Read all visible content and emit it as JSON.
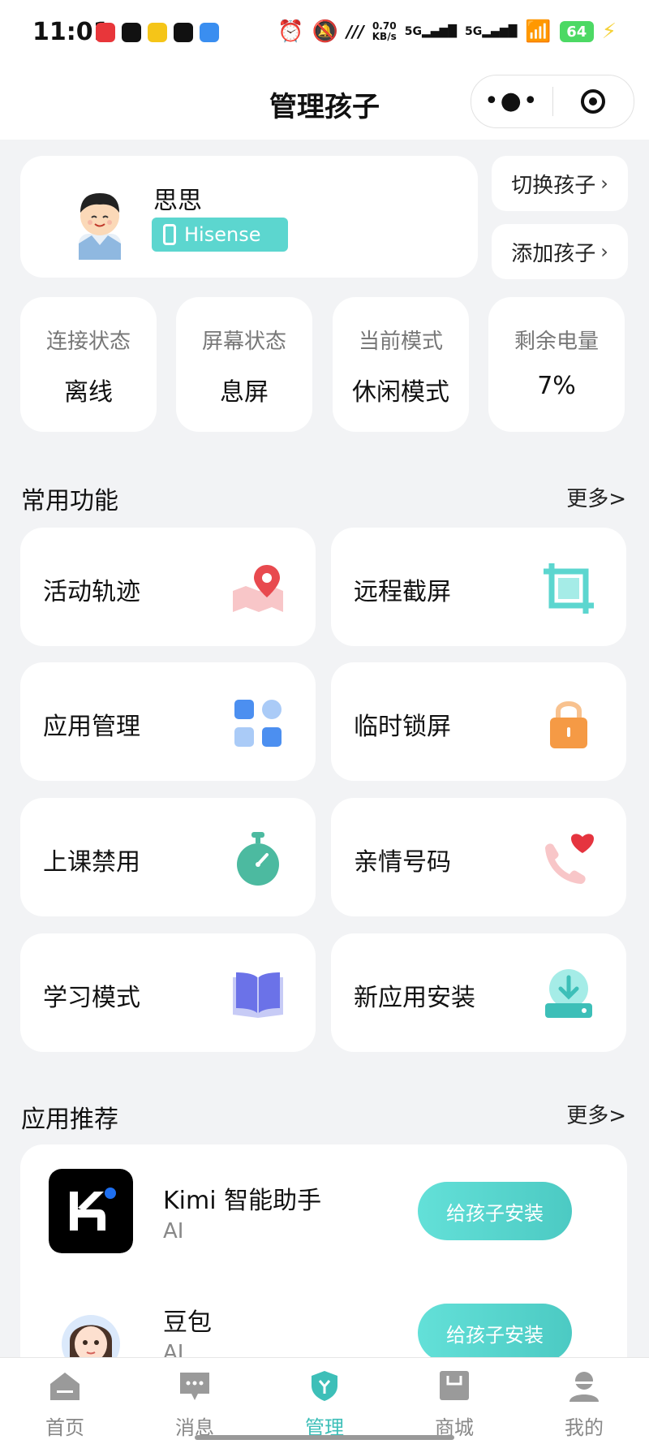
{
  "status_bar": {
    "time": "11:01",
    "net_speed_value": "0.70",
    "net_speed_unit": "KB/s",
    "signal_1": "5G",
    "signal_2": "5G",
    "battery": "64",
    "app_colors": [
      "#e8363a",
      "#111111",
      "#f5c518",
      "#111111",
      "#3a8ef0"
    ]
  },
  "header": {
    "title": "管理孩子",
    "more_icon": "more-dots-icon",
    "target_icon": "target-icon"
  },
  "profile": {
    "name": "思思",
    "device": "Hisense",
    "switch_label": "切换孩子",
    "add_label": "添加孩子"
  },
  "stats": [
    {
      "label": "连接状态",
      "value": "离线"
    },
    {
      "label": "屏幕状态",
      "value": "息屏"
    },
    {
      "label": "当前模式",
      "value": "休闲模式"
    },
    {
      "label": "剩余电量",
      "value": "7%"
    }
  ],
  "common_functions": {
    "title": "常用功能",
    "more": "更多>",
    "items": [
      {
        "label": "活动轨迹",
        "icon": "map-pin-icon"
      },
      {
        "label": "远程截屏",
        "icon": "crop-screen-icon"
      },
      {
        "label": "应用管理",
        "icon": "app-grid-icon"
      },
      {
        "label": "临时锁屏",
        "icon": "lock-icon"
      },
      {
        "label": "上课禁用",
        "icon": "stopwatch-icon"
      },
      {
        "label": "亲情号码",
        "icon": "phone-heart-icon"
      },
      {
        "label": "学习模式",
        "icon": "book-icon"
      },
      {
        "label": "新应用安装",
        "icon": "download-icon"
      }
    ]
  },
  "recommend": {
    "title": "应用推荐",
    "more": "更多>",
    "apps": [
      {
        "name": "Kimi 智能助手",
        "category": "AI",
        "button": "给孩子安装"
      },
      {
        "name": "豆包",
        "category": "AI",
        "button": "给孩子安装"
      }
    ]
  },
  "tabs": [
    {
      "label": "首页",
      "icon": "home-icon"
    },
    {
      "label": "消息",
      "icon": "message-icon"
    },
    {
      "label": "管理",
      "icon": "shield-icon"
    },
    {
      "label": "商城",
      "icon": "store-icon"
    },
    {
      "label": "我的",
      "icon": "profile-icon"
    }
  ],
  "colors": {
    "accent": "#3dbfb8",
    "device_badge": "#5cd6cf",
    "lock": "#f59a45",
    "map_pin": "#e84a4f",
    "app_grid": "#4c8ff0",
    "book": "#6b72e8"
  }
}
